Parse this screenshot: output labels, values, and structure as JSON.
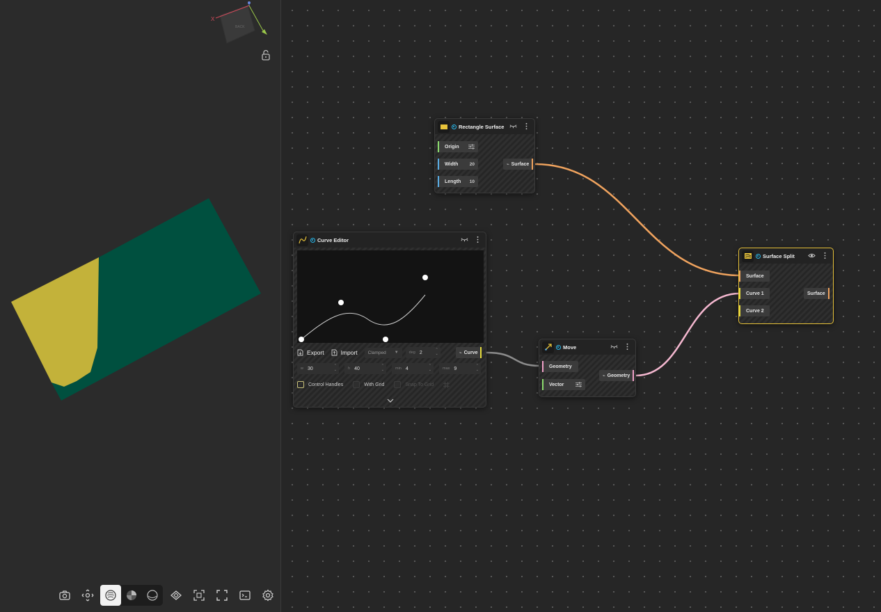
{
  "viewport": {
    "gizmo": {
      "x_axis_label": "X",
      "cube_label": "BACK"
    },
    "toolbar": [
      {
        "name": "camera-icon"
      },
      {
        "name": "orbit-icon"
      },
      {
        "name": "shaded-sphere-icon",
        "active": true
      },
      {
        "name": "material-sphere-icon"
      },
      {
        "name": "wire-sphere-icon"
      },
      {
        "name": "layers-icon"
      },
      {
        "name": "frame-selection-icon"
      },
      {
        "name": "fullscreen-icon"
      },
      {
        "name": "console-icon"
      },
      {
        "name": "settings-icon"
      }
    ],
    "colors": {
      "surface_a": "#00503f",
      "surface_b": "#c3b23a"
    }
  },
  "nodes": {
    "rectangle_surface": {
      "title": "Rectangle Surface",
      "inputs": [
        {
          "label": "Origin",
          "value": "",
          "color": "#8cdc6e"
        },
        {
          "label": "Width",
          "value": "20",
          "color": "#5aaee6"
        },
        {
          "label": "Length",
          "value": "10",
          "color": "#5aaee6"
        }
      ],
      "output": {
        "label": "Surface",
        "color": "#f0a35e"
      }
    },
    "curve_editor": {
      "title": "Curve Editor",
      "export_label": "Export",
      "import_label": "Import",
      "mode": "Clamped",
      "degree_label": "deg",
      "degree": "2",
      "output": {
        "label": "Curve",
        "color": "#e6dc3c"
      },
      "fields": [
        {
          "label": "w",
          "value": "30"
        },
        {
          "label": "h",
          "value": "40"
        },
        {
          "label": "min",
          "value": "4"
        },
        {
          "label": "max",
          "value": "9"
        }
      ],
      "checks": [
        {
          "label": "Control Handles",
          "checked": true
        },
        {
          "label": "With Grid",
          "checked": false
        },
        {
          "label": "Snap To Grid",
          "checked": false
        }
      ]
    },
    "move": {
      "title": "Move",
      "inputs": [
        {
          "label": "Geometry",
          "color": "#f0a0c8"
        },
        {
          "label": "Vector",
          "color": "#8cdc6e"
        }
      ],
      "output": {
        "label": "Geometry",
        "color": "#f0a0c8"
      }
    },
    "surface_split": {
      "title": "Surface Split",
      "inputs": [
        {
          "label": "Surface",
          "color": "#f0a35e"
        },
        {
          "label": "Curve 1",
          "color": "#e6dc3c"
        },
        {
          "label": "Curve 2",
          "color": "#e6dc3c"
        }
      ],
      "output": {
        "label": "Surface",
        "color": "#f0a35e"
      }
    }
  },
  "wire_colors": {
    "surface": "#f0a35e",
    "curve": "#8c8c8c",
    "geometry": "#f5b8d0"
  }
}
